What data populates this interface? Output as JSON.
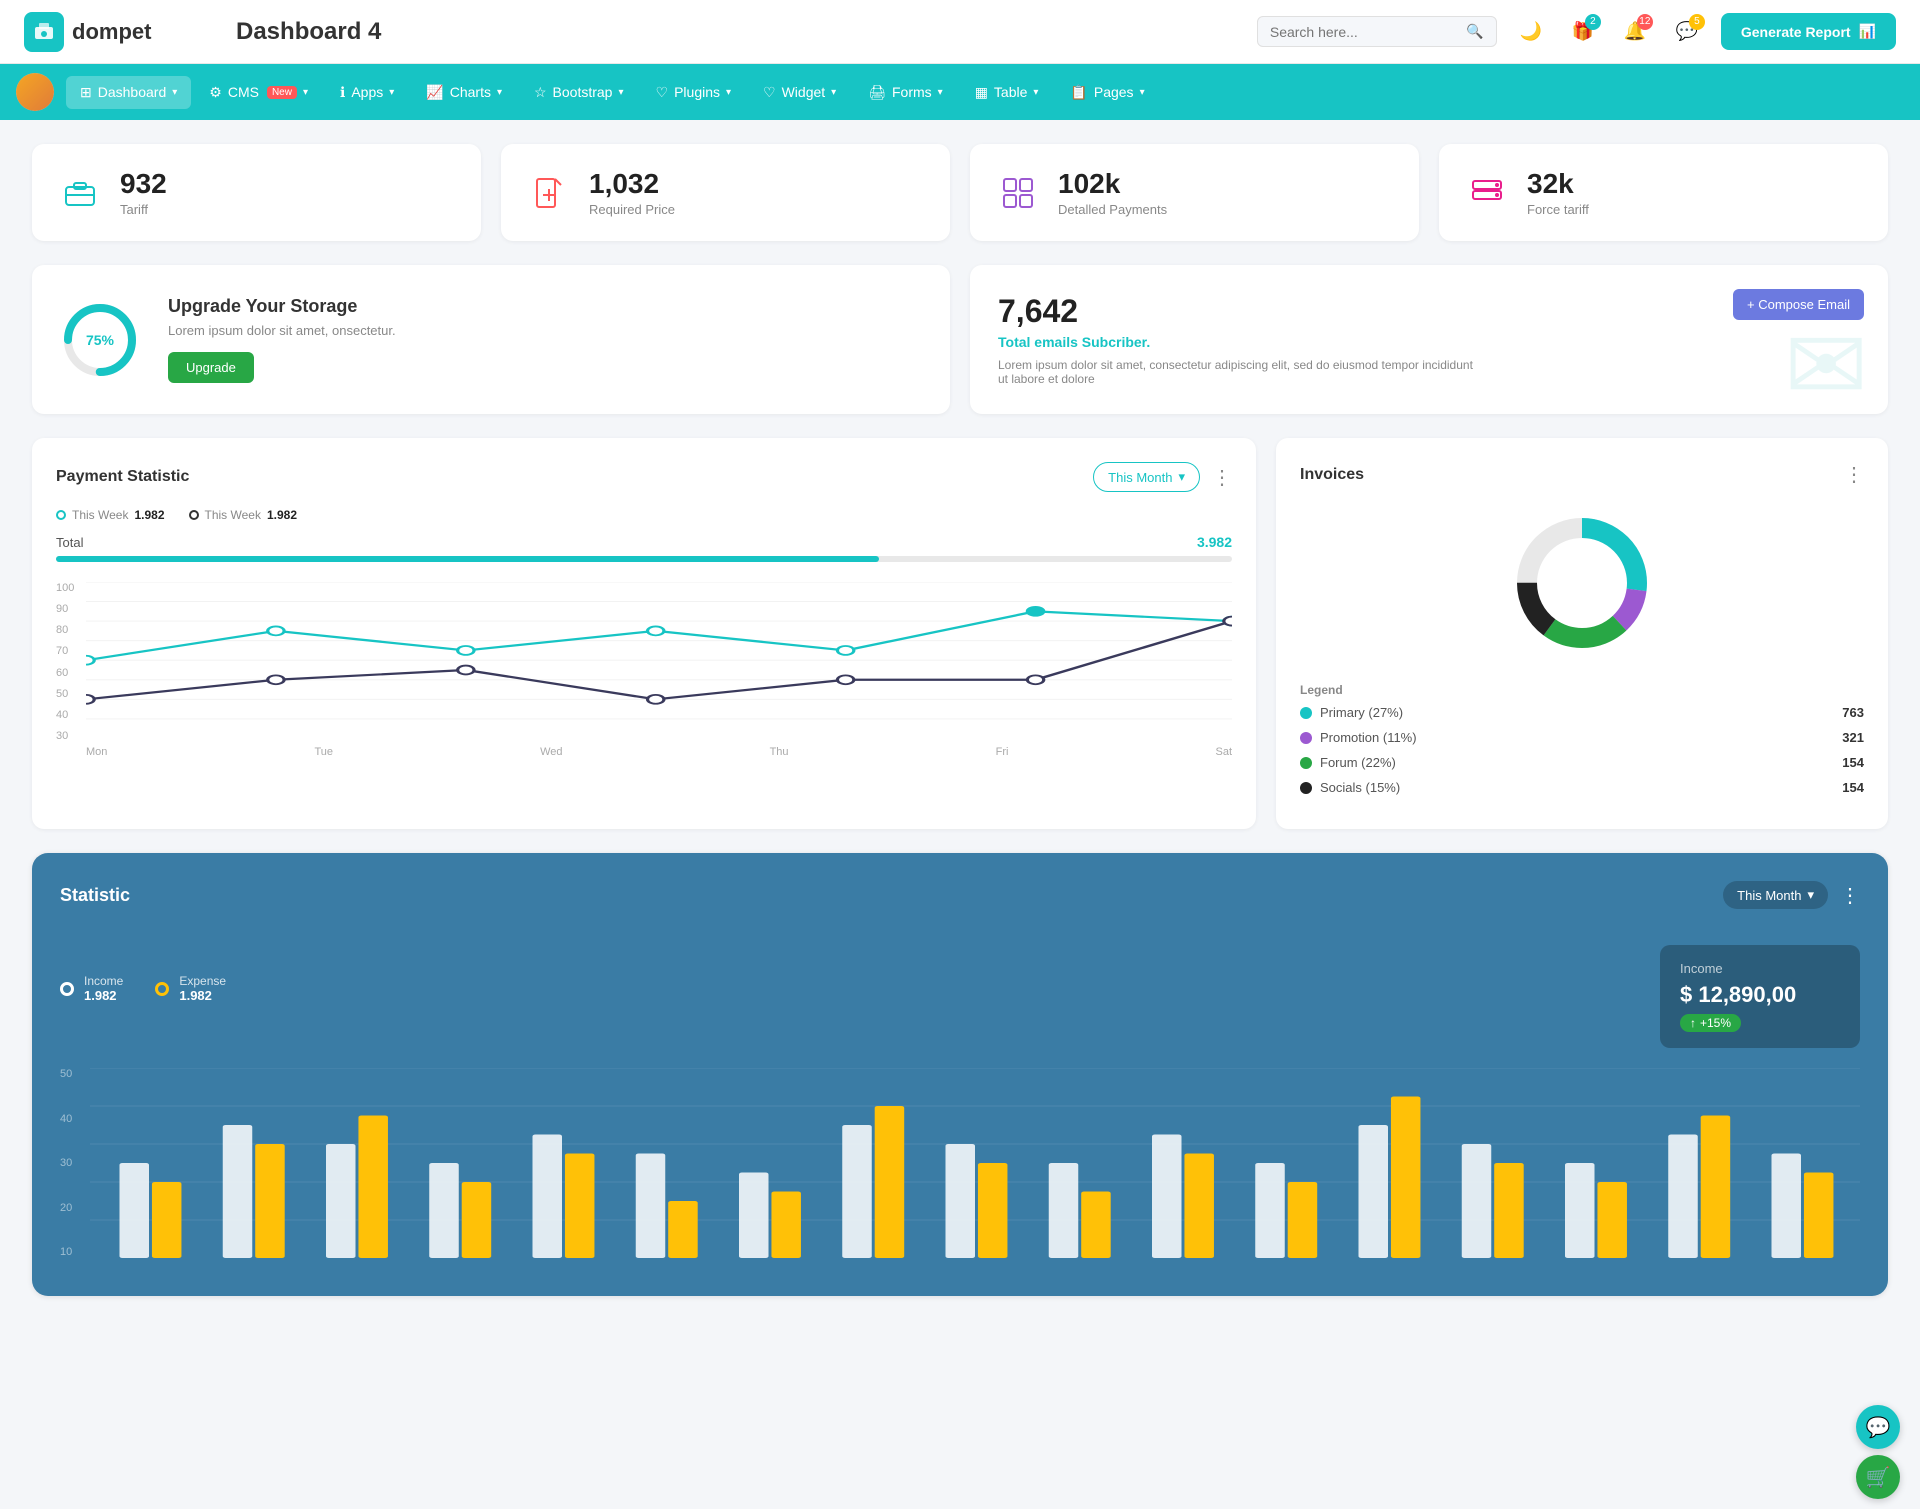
{
  "header": {
    "logo_text": "dompet",
    "title": "Dashboard 4",
    "search_placeholder": "Search here...",
    "generate_btn": "Generate Report",
    "badges": {
      "gift": "2",
      "bell": "12",
      "chat": "5"
    }
  },
  "nav": {
    "items": [
      {
        "label": "Dashboard",
        "active": true,
        "has_arrow": true
      },
      {
        "label": "CMS",
        "badge": "New",
        "has_arrow": true
      },
      {
        "label": "Apps",
        "has_arrow": true
      },
      {
        "label": "Charts",
        "has_arrow": true
      },
      {
        "label": "Bootstrap",
        "has_arrow": true
      },
      {
        "label": "Plugins",
        "has_arrow": true
      },
      {
        "label": "Widget",
        "has_arrow": true
      },
      {
        "label": "Forms",
        "has_arrow": true
      },
      {
        "label": "Table",
        "has_arrow": true
      },
      {
        "label": "Pages",
        "has_arrow": true
      }
    ]
  },
  "stat_cards": [
    {
      "value": "932",
      "label": "Tariff",
      "icon": "briefcase",
      "color": "teal"
    },
    {
      "value": "1,032",
      "label": "Required Price",
      "icon": "file-plus",
      "color": "red"
    },
    {
      "value": "102k",
      "label": "Detalled Payments",
      "icon": "grid",
      "color": "purple"
    },
    {
      "value": "32k",
      "label": "Force tariff",
      "icon": "server",
      "color": "pink"
    }
  ],
  "storage": {
    "title": "Upgrade Your Storage",
    "desc": "Lorem ipsum dolor sit amet, onsectetur.",
    "percent": 75,
    "btn_label": "Upgrade"
  },
  "email": {
    "count": "7,642",
    "label": "Total emails Subcriber.",
    "desc": "Lorem ipsum dolor sit amet, consectetur adipiscing elit, sed do eiusmod tempor incididunt ut labore et dolore",
    "compose_btn": "+ Compose Email"
  },
  "payment": {
    "title": "Payment Statistic",
    "this_month": "This Month",
    "legend": [
      {
        "label": "This Week",
        "value": "1.982",
        "color": "teal"
      },
      {
        "label": "This Week",
        "value": "1.982",
        "color": "dark"
      }
    ],
    "total_label": "Total",
    "total_value": "3.982",
    "x_labels": [
      "Mon",
      "Tue",
      "Wed",
      "Thu",
      "Fri",
      "Sat"
    ],
    "y_labels": [
      "100",
      "90",
      "80",
      "70",
      "60",
      "50",
      "40",
      "30"
    ]
  },
  "invoices": {
    "title": "Invoices",
    "legend_title": "Legend",
    "items": [
      {
        "label": "Primary (27%)",
        "color": "#17c4c4",
        "value": "763"
      },
      {
        "label": "Promotion (11%)",
        "color": "#9c59d1",
        "value": "321"
      },
      {
        "label": "Forum (22%)",
        "color": "#28a745",
        "value": "154"
      },
      {
        "label": "Socials (15%)",
        "color": "#333",
        "value": "154"
      }
    ],
    "donut": {
      "segments": [
        {
          "pct": 27,
          "color": "#17c4c4"
        },
        {
          "pct": 11,
          "color": "#9c59d1"
        },
        {
          "pct": 22,
          "color": "#28a745"
        },
        {
          "pct": 15,
          "color": "#222"
        }
      ]
    }
  },
  "statistic": {
    "title": "Statistic",
    "this_month": "This Month",
    "income_label": "Income",
    "income_value": "1.982",
    "expense_label": "Expense",
    "expense_value": "1.982",
    "income_detail_label": "Income",
    "income_detail_value": "$ 12,890,00",
    "income_badge": "+15%",
    "y_labels": [
      "50",
      "40",
      "30",
      "20",
      "10"
    ]
  },
  "floating": {
    "chat_icon": "💬",
    "cart_icon": "🛒"
  }
}
